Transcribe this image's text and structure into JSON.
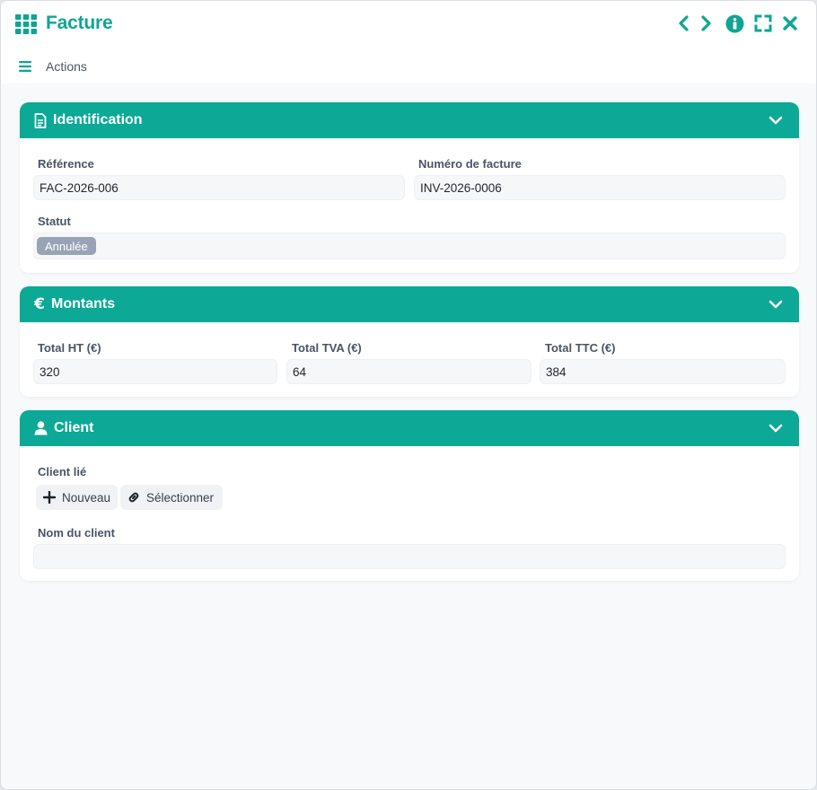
{
  "window": {
    "title": "Facture",
    "app_icon": "grid-icon",
    "controls": [
      "previous-icon",
      "next-icon",
      "info-icon",
      "expand-icon",
      "close-icon"
    ],
    "accent_color": "#0fa593"
  },
  "toolbar": {
    "actions_label": "Actions",
    "menu_icon": "menu-icon"
  },
  "sections": {
    "identification": {
      "title": "Identification",
      "icon": "document-icon",
      "reference_label": "Référence",
      "reference_value": "FAC-2026-006",
      "number_label": "Numéro de facture",
      "number_value": "INV-2026-0006",
      "status_label": "Statut",
      "status_value": "Annulée"
    },
    "amounts": {
      "title": "Montants",
      "icon": "euro-icon",
      "total_ht_label": "Total HT (€)",
      "total_ht_value": "320",
      "total_tva_label": "Total TVA (€)",
      "total_tva_value": "64",
      "total_ttc_label": "Total TTC (€)",
      "total_ttc_value": "384"
    },
    "client": {
      "title": "Client",
      "icon": "user-icon",
      "linked_label": "Client lié",
      "new_button": "Nouveau",
      "select_button": "Sélectionner",
      "name_label": "Nom du client",
      "name_value": ""
    }
  },
  "colors": {
    "section_header": "#0ba996",
    "badge": "#98a4b5"
  }
}
